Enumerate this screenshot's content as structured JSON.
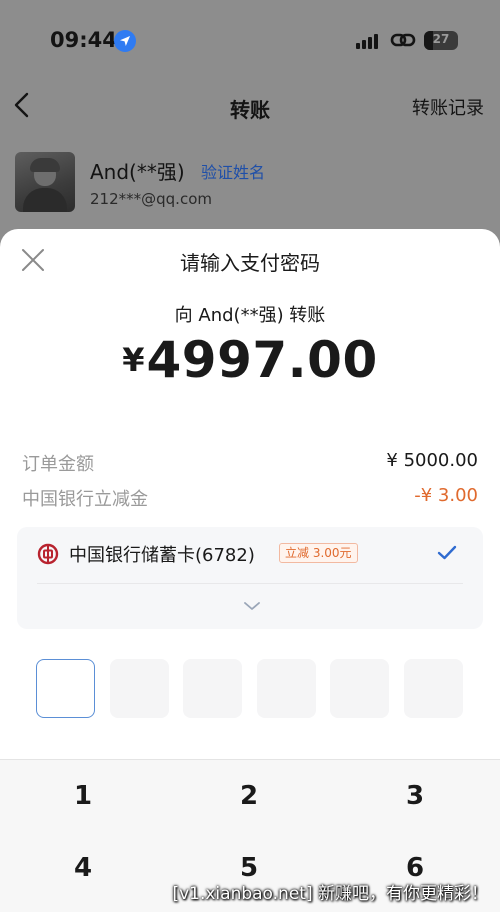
{
  "status_bar": {
    "time": "09:44",
    "battery": "27"
  },
  "nav": {
    "title": "转账",
    "right_link": "转账记录"
  },
  "recipient": {
    "name": "And(**强)",
    "verify_link": "验证姓名",
    "account": "212***@qq.com"
  },
  "payment": {
    "title": "请输入支付密码",
    "to_line": "向 And(**强) 转账",
    "currency_symbol": "¥",
    "amount": "4997.00",
    "order_label": "订单金额",
    "order_value": "¥ 5000.00",
    "discount_label": "中国银行立减金",
    "discount_value": "-¥ 3.00",
    "card_name": "中国银行储蓄卡(6782)",
    "card_promo": "立减 3.00元",
    "accent_color": "#2f6bd0",
    "discount_color": "#e06a2e"
  },
  "keypad": {
    "keys": [
      "1",
      "2",
      "3",
      "4",
      "5",
      "6"
    ]
  },
  "watermark": "[v1.xianbao.net] 新赚吧，有你更精彩！"
}
